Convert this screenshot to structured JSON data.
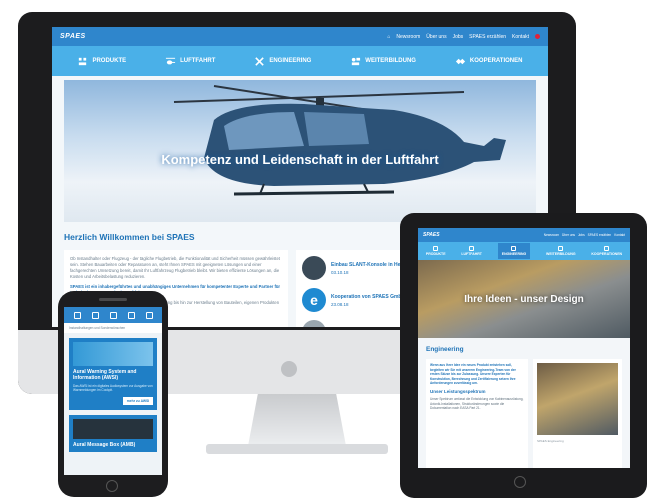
{
  "desktop": {
    "logo": "SPAES",
    "topnav": [
      "Newsroom",
      "Über uns",
      "Jobs",
      "SPAES erzählen",
      "Kontakt"
    ],
    "mainnav": [
      {
        "label": "PRODUKTE",
        "icon": "product-icon"
      },
      {
        "label": "LUFTFAHRT",
        "icon": "helicopter-icon"
      },
      {
        "label": "ENGINEERING",
        "icon": "tools-icon"
      },
      {
        "label": "WEITERBILDUNG",
        "icon": "training-icon"
      },
      {
        "label": "KOOPERATIONEN",
        "icon": "handshake-icon"
      }
    ],
    "hero_title": "Kompetenz und Leidenschaft in der Luftfahrt",
    "welcome": "Herzlich Willkommen bei SPAES",
    "intro": [
      "Ob Instandhalter oder Flugzeug - der tägliche Flugbetrieb, die Funktionalität und Sicherheit müssen gewährleistet sein. Stehen Bauarbeiten oder Reparaturen an, steht Ihnen SPAES mit geeigneten Lösungen und einer fachgerechten Umsetzung bereit, damit Ihr Luftfahrzeug Flugbetrieb bleibt. Wir bieten effiziente Lösungen an, die Kosten und Arbeitsbelastung reduzieren.",
      "SPAES ist ein inhabergeführtes und unabhängiges Unternehmen für kompetenter Experte und Partner für technische Lösungen in der Luftfahrt.",
      "Von der Idee über die Konzeptionierung und Zulassung bis hin zur Herstellung von Bauteilen, eigenen Produkten und Systemen sind wir Ihr Partner für die Luftfahrt."
    ],
    "news": [
      {
        "title": "Einbau SLANT-Konsole in He",
        "date": "03.10.18"
      },
      {
        "title": "Kooperation von SPAES Gmb",
        "date": "23.08.18"
      }
    ]
  },
  "tablet": {
    "logo": "SPAES",
    "topnav": [
      "Newsroom",
      "Über uns",
      "Jobs",
      "SPAES erzählen",
      "Kontakt"
    ],
    "mainnav": [
      "PRODUKTE",
      "LUFTFAHRT",
      "ENGINEERING",
      "WEITERBILDUNG",
      "KOOPERATIONEN"
    ],
    "hero_title": "Ihre Ideen - unser Design",
    "heading": "Engineering",
    "body": "Wenn aus Ihrer Idee ein neues Produkt entstehen soll, begleiten wir Sie mit unserem Engineering-Team von der ersten Skizze bis zur Zulassung. Unsere Experten für Konstruktion, Berechnung und Zertifizierung setzen Ihre Anforderungen zuverlässig um.",
    "subheading": "Unser Leistungsspektrum",
    "body2": "Unser Spektrum umfasst die Entwicklung von Kabinenausrüstung, Avionik-Installationen, Strukturänderungen sowie die Dokumentation nach EASA Part 21.",
    "caption": "SPAES Engineering"
  },
  "phone": {
    "intro": "Instandhaltungen und Sonderwünschen",
    "card1_title": "Aural Warning System and Information (AWSI)",
    "card1_text": "Das AWSI ist ein digitales Audiosystem zur Ausgabe von Warnmeldungen im Cockpit.",
    "card1_button": "mehr zu AWSI",
    "card2_title": "Aural Message Box (AMB)"
  },
  "colors": {
    "brand_dark": "#2f86cc",
    "brand_light": "#4ab0e8",
    "heading_blue": "#1e73b7"
  }
}
